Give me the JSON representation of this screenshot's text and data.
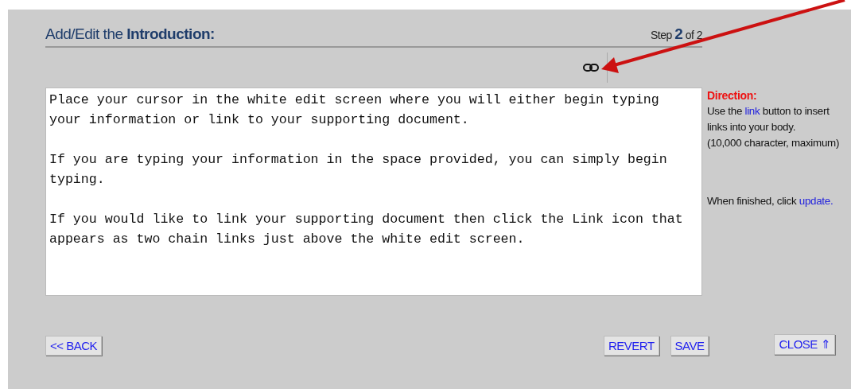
{
  "header": {
    "title": "Add/Edit the **Introduction:**",
    "step": "Step **2** of 2"
  },
  "editor": {
    "paragraphs": [
      "Place your cursor in the white edit screen where you will either begin typing your information or link to your supporting document.",
      "If you are typing your information in the space provided, you can simply begin typing.",
      "If you would like to link your supporting document then click the Link icon that appears as two chain links just above the white edit screen."
    ]
  },
  "direction": {
    "heading": "Direction:",
    "before_link": "Use the",
    "link": "link",
    "after_link": "button to insert links into your body.",
    "limit": "(10,000 character, maximum)",
    "finish_text": "When finished, click",
    "finish_link": "update."
  },
  "buttons": {
    "back": "<< BACK",
    "revert": "REVERT",
    "save": "SAVE",
    "close": "CLOSE",
    "close_icon": "⇑"
  }
}
